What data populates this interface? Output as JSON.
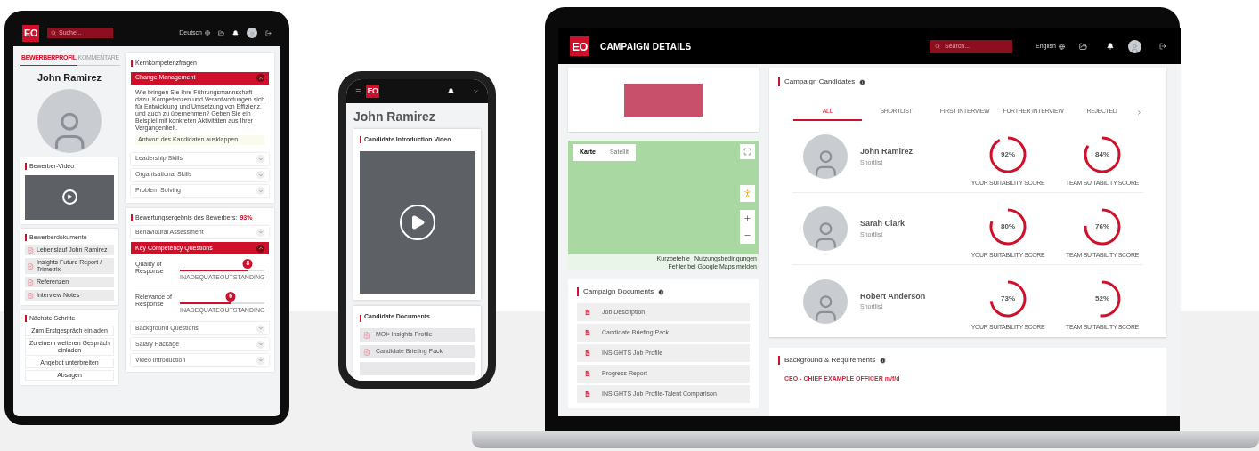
{
  "tablet": {
    "header": {
      "logo": "EO",
      "search_placeholder": "Suche...",
      "language": "Deutsch"
    },
    "profile_tabs": [
      {
        "label": "BEWERBERPROFIL",
        "selected": true
      },
      {
        "label": "KOMMENTARE",
        "selected": false
      }
    ],
    "candidate_name": "John Ramirez",
    "video_card": {
      "title": "Bewerber-Video"
    },
    "documents": {
      "title": "Bewerberdokumente",
      "items": [
        "Lebenslauf John Ramirez",
        "Insights Future Report / Trimetrix",
        "Referenzen",
        "Interview Notes"
      ]
    },
    "next_steps": {
      "title": "Nächste Schritte",
      "buttons": [
        "Zum Erstgespräch einladen",
        "Zu einem weiteren Gespräch einladen",
        "Angebot unterbreiten",
        "Absagen"
      ]
    },
    "core_questions": {
      "title": "Kernkompetenzfragen",
      "items": [
        {
          "label": "Change Management",
          "expanded": true,
          "text": "Wie bringen Sie Ihre Führungsmannschaft dazu, Kompetenzen und Verantwortungen sich für Entwicklung und Umsetzung von Effizienz, und auch zu übernehmen? Geben Sie ein Beispiel mit konkreten Aktivitäten aus Ihrer Vergangenheit.",
          "answer_toggle": "Antwort des Kandidaten ausklappen"
        },
        {
          "label": "Leadership Skills",
          "expanded": false
        },
        {
          "label": "Organisational Skills",
          "expanded": false
        },
        {
          "label": "Problem Solving",
          "expanded": false
        }
      ]
    },
    "evaluation": {
      "title": "Bewertungsergebnis des Bewerbers:",
      "score": "93%",
      "sections": [
        {
          "label": "Behavioural Assessment",
          "expanded": false
        },
        {
          "label": "Key Competency Questions",
          "expanded": true,
          "ratings": [
            {
              "label": "Quality of Response",
              "badge": "8",
              "level": 0.8,
              "min_label": "INADEQUATE",
              "max_label": "OUTSTANDING"
            },
            {
              "label": "Relevance of Response",
              "badge": "6",
              "level": 0.6,
              "min_label": "INADEQUATE",
              "max_label": "OUTSTANDING"
            }
          ]
        },
        {
          "label": "Background Questions",
          "expanded": false
        },
        {
          "label": "Salary Package",
          "expanded": false
        },
        {
          "label": "Video Introduction",
          "expanded": false
        }
      ]
    }
  },
  "phone": {
    "header": {
      "logo": "EO"
    },
    "candidate_name": "John Ramirez",
    "video_card": {
      "title": "Candidate Introduction Video"
    },
    "documents": {
      "title": "Candidate Documents",
      "items": [
        "MOI² Insights Profile",
        "Candidate Briefing Pack"
      ]
    }
  },
  "laptop": {
    "header": {
      "logo": "EO",
      "title": "CAMPAIGN DETAILS",
      "search_placeholder": "Search...",
      "language": "English"
    },
    "map": {
      "map_type_tabs": [
        {
          "label": "Karte",
          "selected": true
        },
        {
          "label": "Satellit",
          "selected": false
        }
      ],
      "attribution": [
        "Kurzbefehle",
        "Nutzungsbedingungen",
        "Fehler bei Google Maps melden"
      ]
    },
    "documents": {
      "title": "Campaign Documents",
      "items": [
        "Job Description",
        "Candidate Briefing Pack",
        "INSIGHTS Job Profile",
        "Progress Report",
        "INSIGHTS Job Profile-Talent Comparison"
      ]
    },
    "candidates": {
      "title": "Campaign Candidates",
      "tabs": [
        {
          "label": "ALL",
          "selected": true
        },
        {
          "label": "SHORTLIST",
          "selected": false
        },
        {
          "label": "FIRST INTERVIEW",
          "selected": false
        },
        {
          "label": "FURTHER INTERVIEW",
          "selected": false
        },
        {
          "label": "REJECTED",
          "selected": false
        }
      ],
      "rows": [
        {
          "name": "John Ramirez",
          "status": "Shortlist",
          "scores": [
            {
              "value": "92%",
              "label": "YOUR SUITABILITY SCORE"
            },
            {
              "value": "84%",
              "label": "TEAM SUITABILITY SCORE"
            }
          ]
        },
        {
          "name": "Sarah Clark",
          "status": "Shortlist",
          "scores": [
            {
              "value": "80%",
              "label": "YOUR SUITABILITY SCORE"
            },
            {
              "value": "76%",
              "label": "TEAM SUITABILITY SCORE"
            }
          ]
        },
        {
          "name": "Robert Anderson",
          "status": "Shortlist",
          "scores": [
            {
              "value": "73%",
              "label": "YOUR SUITABILITY SCORE"
            },
            {
              "value": "52%",
              "label": "TEAM SUITABILITY SCORE"
            }
          ]
        }
      ]
    },
    "background": {
      "title": "Background & Requirements",
      "position": "CEO - CHIEF EXAMPLE OFFICER m/f/d"
    }
  }
}
